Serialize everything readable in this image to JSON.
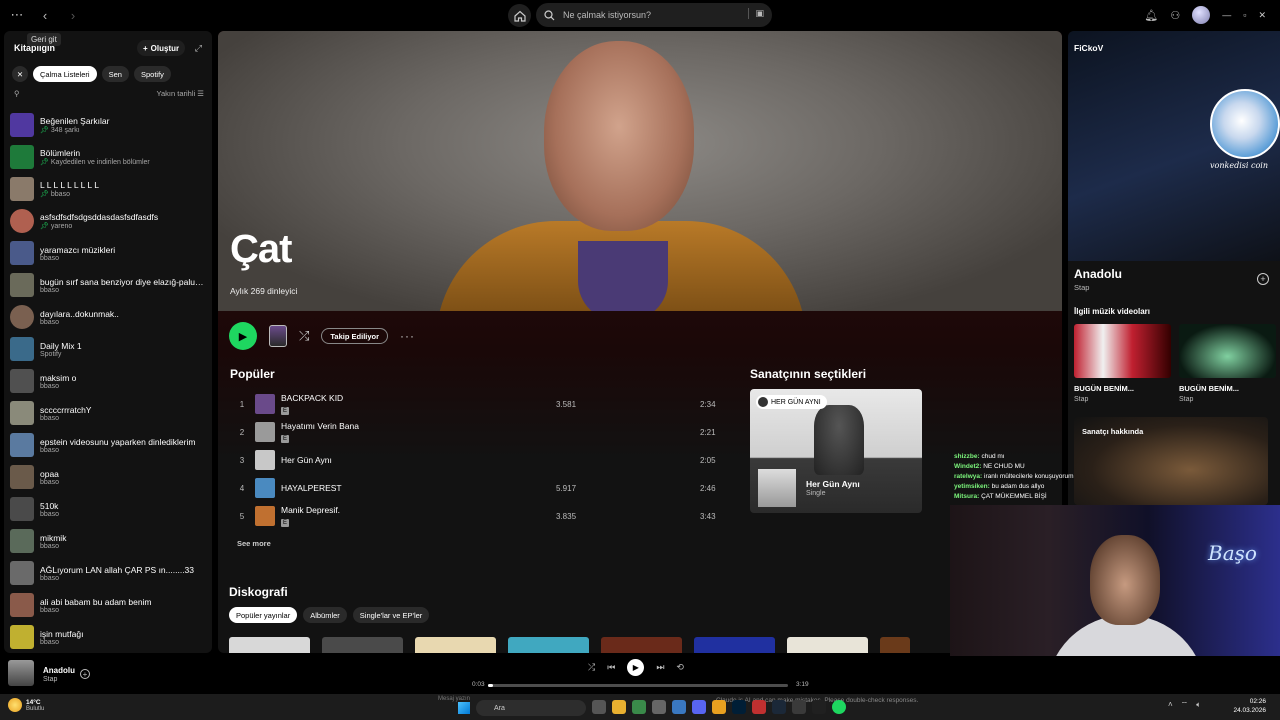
{
  "topbar": {
    "back_tooltip": "Geri git",
    "search_placeholder": "Ne çalmak istiyorsun?"
  },
  "sidebar": {
    "title": "Kitaplığın",
    "create_label": "Oluştur",
    "chips": [
      "Çalma Listeleri",
      "Sen",
      "Spotify"
    ],
    "sort_label": "Yakın tarihli",
    "items": [
      {
        "name": "Beğenilen Şarkılar",
        "sub": "348 şarkı",
        "pinned": true,
        "color": "#5038a0"
      },
      {
        "name": "Bölümlerin",
        "sub": "Kaydedilen ve indirilen bölümler",
        "pinned": true,
        "color": "#1e7a3a"
      },
      {
        "name": "L L L L L L L L L",
        "sub": "bbaso",
        "pinned": true,
        "color": "#8a7a6a"
      },
      {
        "name": "asfsdfsdfsdgsddasdasfsdfasdfs",
        "sub": "yareno",
        "pinned": true,
        "color": "#b06050"
      },
      {
        "name": "yaramazcı müzikleri",
        "sub": "bbaso",
        "pinned": false,
        "color": "#4a5a8a"
      },
      {
        "name": "bugün sırf sana benziyor diye elazığ-palu'lu ...",
        "sub": "bbaso",
        "pinned": false,
        "color": "#6a6a5a"
      },
      {
        "name": "dayılara..dokunmak..",
        "sub": "bbaso",
        "pinned": false,
        "color": "#7a6050"
      },
      {
        "name": "Daily Mix 1",
        "sub": "Spotify",
        "pinned": false,
        "color": "#3a6a8a"
      },
      {
        "name": "maksim o",
        "sub": "bbaso",
        "pinned": false,
        "color": "#505050"
      },
      {
        "name": "sccccrrratchY",
        "sub": "bbaso",
        "pinned": false,
        "color": "#8a8a7a"
      },
      {
        "name": "epstein videosunu yaparken dinlediklerim",
        "sub": "bbaso",
        "pinned": false,
        "color": "#5a7aa0"
      },
      {
        "name": "opaa",
        "sub": "bbaso",
        "pinned": false,
        "color": "#6a5a4a"
      },
      {
        "name": "510k",
        "sub": "bbaso",
        "pinned": false,
        "color": "#4a4a4a"
      },
      {
        "name": "mikmik",
        "sub": "bbaso",
        "pinned": false,
        "color": "#5a6a5a"
      },
      {
        "name": "AĞLıyorum LAN allah ÇAR PS ın........33",
        "sub": "bbaso",
        "pinned": false,
        "color": "#6a6a6a"
      },
      {
        "name": "ali abi babam bu adam benim",
        "sub": "bbaso",
        "pinned": false,
        "color": "#8a5a4a"
      },
      {
        "name": "işin mutfağı",
        "sub": "bbaso",
        "pinned": false,
        "color": "#c0b030"
      }
    ]
  },
  "artist": {
    "name": "Çat",
    "monthly_listeners": "Aylık 269 dinleyici",
    "follow_label": "Takip Ediliyor",
    "popular_title": "Popüler",
    "tracks": [
      {
        "num": "1",
        "title": "BACKPACK KID",
        "plays": "3.581",
        "duration": "2:34",
        "explicit": true,
        "color": "#6a4a8a"
      },
      {
        "num": "2",
        "title": "Hayatımı Verin Bana",
        "plays": "",
        "duration": "2:21",
        "explicit": true,
        "color": "#9a9a9a"
      },
      {
        "num": "3",
        "title": "Her Gün Aynı",
        "plays": "",
        "duration": "2:05",
        "explicit": false,
        "color": "#c8c8c8"
      },
      {
        "num": "4",
        "title": "HAYALPEREST",
        "plays": "5.917",
        "duration": "2:46",
        "explicit": false,
        "color": "#4a8ac0"
      },
      {
        "num": "5",
        "title": "Manik Depresif.",
        "plays": "3.835",
        "duration": "3:43",
        "explicit": true,
        "color": "#c07030"
      }
    ],
    "see_more": "See more",
    "picks_title": "Sanatçının seçtikleri",
    "pick": {
      "tag": "HER GÜN AYNI",
      "title": "Her Gün Aynı",
      "type": "Single"
    },
    "discography_title": "Diskografi",
    "discography_chips": [
      "Popüler yayınlar",
      "Albümler",
      "Single'lar ve EP'ler"
    ]
  },
  "right_panel": {
    "title": "FiCkoV",
    "overlay_text": "vonkedisi coin",
    "song": "Anadolu",
    "artist": "Stap",
    "videos_title": "İlgili müzik videoları",
    "videos": [
      {
        "title": "BUGÜN BENİM...",
        "artist": "Stap"
      },
      {
        "title": "BUGÜN BENİM...",
        "artist": "Stap"
      }
    ],
    "about_title": "Sanatçı hakkında"
  },
  "chat": [
    {
      "user": "shizzbe:",
      "msg": "chud mı"
    },
    {
      "user": "Windet2:",
      "msg": "NE CHUD MU"
    },
    {
      "user": "ratelwya:",
      "msg": "iranlı mültecilerle konuşuyorum"
    },
    {
      "user": "yetimsiken:",
      "msg": "bu adam dus allyo"
    },
    {
      "user": "Mitsura:",
      "msg": "ÇAT MÜKEMMEL BİŞİ"
    }
  ],
  "webcam": {
    "neon_text": "Başo"
  },
  "now_playing": {
    "title": "Anadolu",
    "artist": "Stap",
    "elapsed": "0:03",
    "total": "3:19",
    "progress": 0.015
  },
  "taskbar": {
    "temp": "14°C",
    "weather": "Bulutlu",
    "search_label": "Ara",
    "notice": "Claude is AI and can make mistakes. Please double-check responses.",
    "notice_input": "Mesaj yazın",
    "time": "02:26",
    "date": "24.03.2026"
  }
}
